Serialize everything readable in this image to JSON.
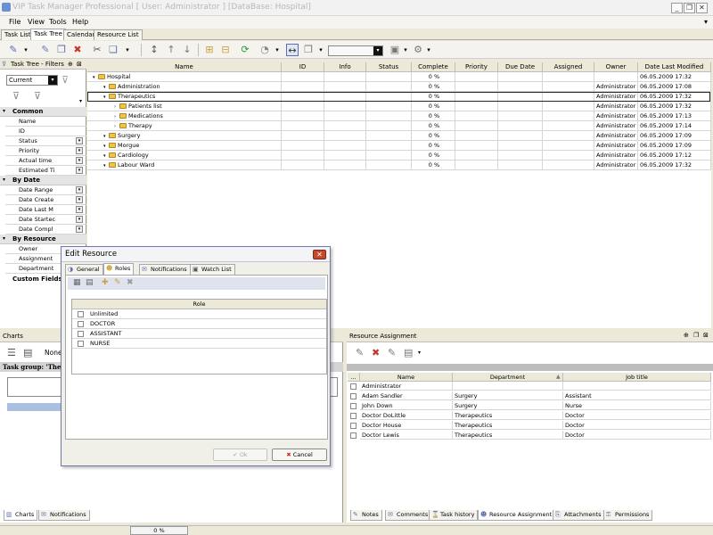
{
  "window": {
    "title": "VIP Task Manager Professional [ User: Administrator ] [DataBase: Hospital]",
    "minimize": "_",
    "maximize": "❐",
    "close": "✕"
  },
  "menu": [
    "File",
    "View",
    "Tools",
    "Help"
  ],
  "doc_tabs": [
    "Task List",
    "Task Tree",
    "Calendar",
    "Resource List"
  ],
  "left_panel": {
    "title": "Task Tree - Filters",
    "filter_select": "Current",
    "groups": [
      {
        "name": "Common",
        "items": [
          {
            "label": "Name",
            "dd": false
          },
          {
            "label": "ID",
            "dd": false
          },
          {
            "label": "Status",
            "dd": true
          },
          {
            "label": "Priority",
            "dd": true
          },
          {
            "label": "Actual time",
            "dd": true
          },
          {
            "label": "Estimated Ti",
            "dd": true
          }
        ]
      },
      {
        "name": "By Date",
        "items": [
          {
            "label": "Date Range",
            "dd": true
          },
          {
            "label": "Date Create",
            "dd": true
          },
          {
            "label": "Date Last M",
            "dd": true
          },
          {
            "label": "Date Startec",
            "dd": true
          },
          {
            "label": "Date Compl",
            "dd": true
          }
        ]
      },
      {
        "name": "By Resource",
        "items": [
          {
            "label": "Owner",
            "dd": false
          },
          {
            "label": "Assignment",
            "dd": false
          },
          {
            "label": "Department",
            "dd": false
          }
        ]
      }
    ],
    "custom_fields": "Custom Fields"
  },
  "grid": {
    "columns": [
      "Name",
      "ID",
      "Info",
      "Status",
      "Complete",
      "Priority",
      "Due Date",
      "Assigned",
      "Owner",
      "Date Last Modified"
    ],
    "rows": [
      {
        "name": "Hospital",
        "level": 0,
        "complete": "0 %",
        "owner": "",
        "modified": "06.05.2009 17:32"
      },
      {
        "name": "Administration",
        "level": 1,
        "complete": "0 %",
        "owner": "Administrator",
        "modified": "06.05.2009 17:08"
      },
      {
        "name": "Therapeutics",
        "level": 1,
        "complete": "0 %",
        "owner": "Administrator",
        "modified": "06.05.2009 17:32"
      },
      {
        "name": "Patients list",
        "level": 2,
        "complete": "0 %",
        "owner": "Administrator",
        "modified": "06.05.2009 17:32"
      },
      {
        "name": "Medications",
        "level": 2,
        "complete": "0 %",
        "owner": "Administrator",
        "modified": "06.05.2009 17:13"
      },
      {
        "name": "Therapy",
        "level": 2,
        "complete": "0 %",
        "owner": "Administrator",
        "modified": "06.05.2009 17:14"
      },
      {
        "name": "Surgery",
        "level": 1,
        "complete": "0 %",
        "owner": "Administrator",
        "modified": "06.05.2009 17:09"
      },
      {
        "name": "Morgue",
        "level": 1,
        "complete": "0 %",
        "owner": "Administrator",
        "modified": "06.05.2009 17:09"
      },
      {
        "name": "Cardiology",
        "level": 1,
        "complete": "0 %",
        "owner": "Administrator",
        "modified": "06.05.2009 17:12"
      },
      {
        "name": "Labour Ward",
        "level": 1,
        "complete": "0 %",
        "owner": "Administrator",
        "modified": "06.05.2009 17:32"
      }
    ]
  },
  "charts_panel": {
    "title": "Charts",
    "mode": "None",
    "task_group": "Task group: 'Ther",
    "tabs": [
      "Charts",
      "Notifications"
    ]
  },
  "resource_panel": {
    "title": "Resource Assignment",
    "columns": [
      "...",
      "Name",
      "Department",
      "Job title"
    ],
    "rows": [
      {
        "name": "Administrator",
        "department": "",
        "job": ""
      },
      {
        "name": "Adam Sandler",
        "department": "Surgery",
        "job": "Assistant"
      },
      {
        "name": "John Down",
        "department": "Surgery",
        "job": "Nurse"
      },
      {
        "name": "Doctor DoLittle",
        "department": "Therapeutics",
        "job": "Doctor"
      },
      {
        "name": "Doctor House",
        "department": "Therapeutics",
        "job": "Doctor"
      },
      {
        "name": "Doctor Lewis",
        "department": "Therapeutics",
        "job": "Doctor"
      }
    ],
    "tabs": [
      "Notes",
      "Comments",
      "Task history",
      "Resource Assignment",
      "Attachments",
      "Permissions"
    ]
  },
  "dialog": {
    "title": "Edit Resource",
    "tabs": [
      "General",
      "Roles",
      "Notifications",
      "Watch List"
    ],
    "role_header": "Role",
    "roles": [
      "Unlimited",
      "DOCTOR",
      "ASSISTANT",
      "NURSE"
    ],
    "ok": "Ok",
    "cancel": "Cancel"
  },
  "status": {
    "progress": "0 %"
  }
}
